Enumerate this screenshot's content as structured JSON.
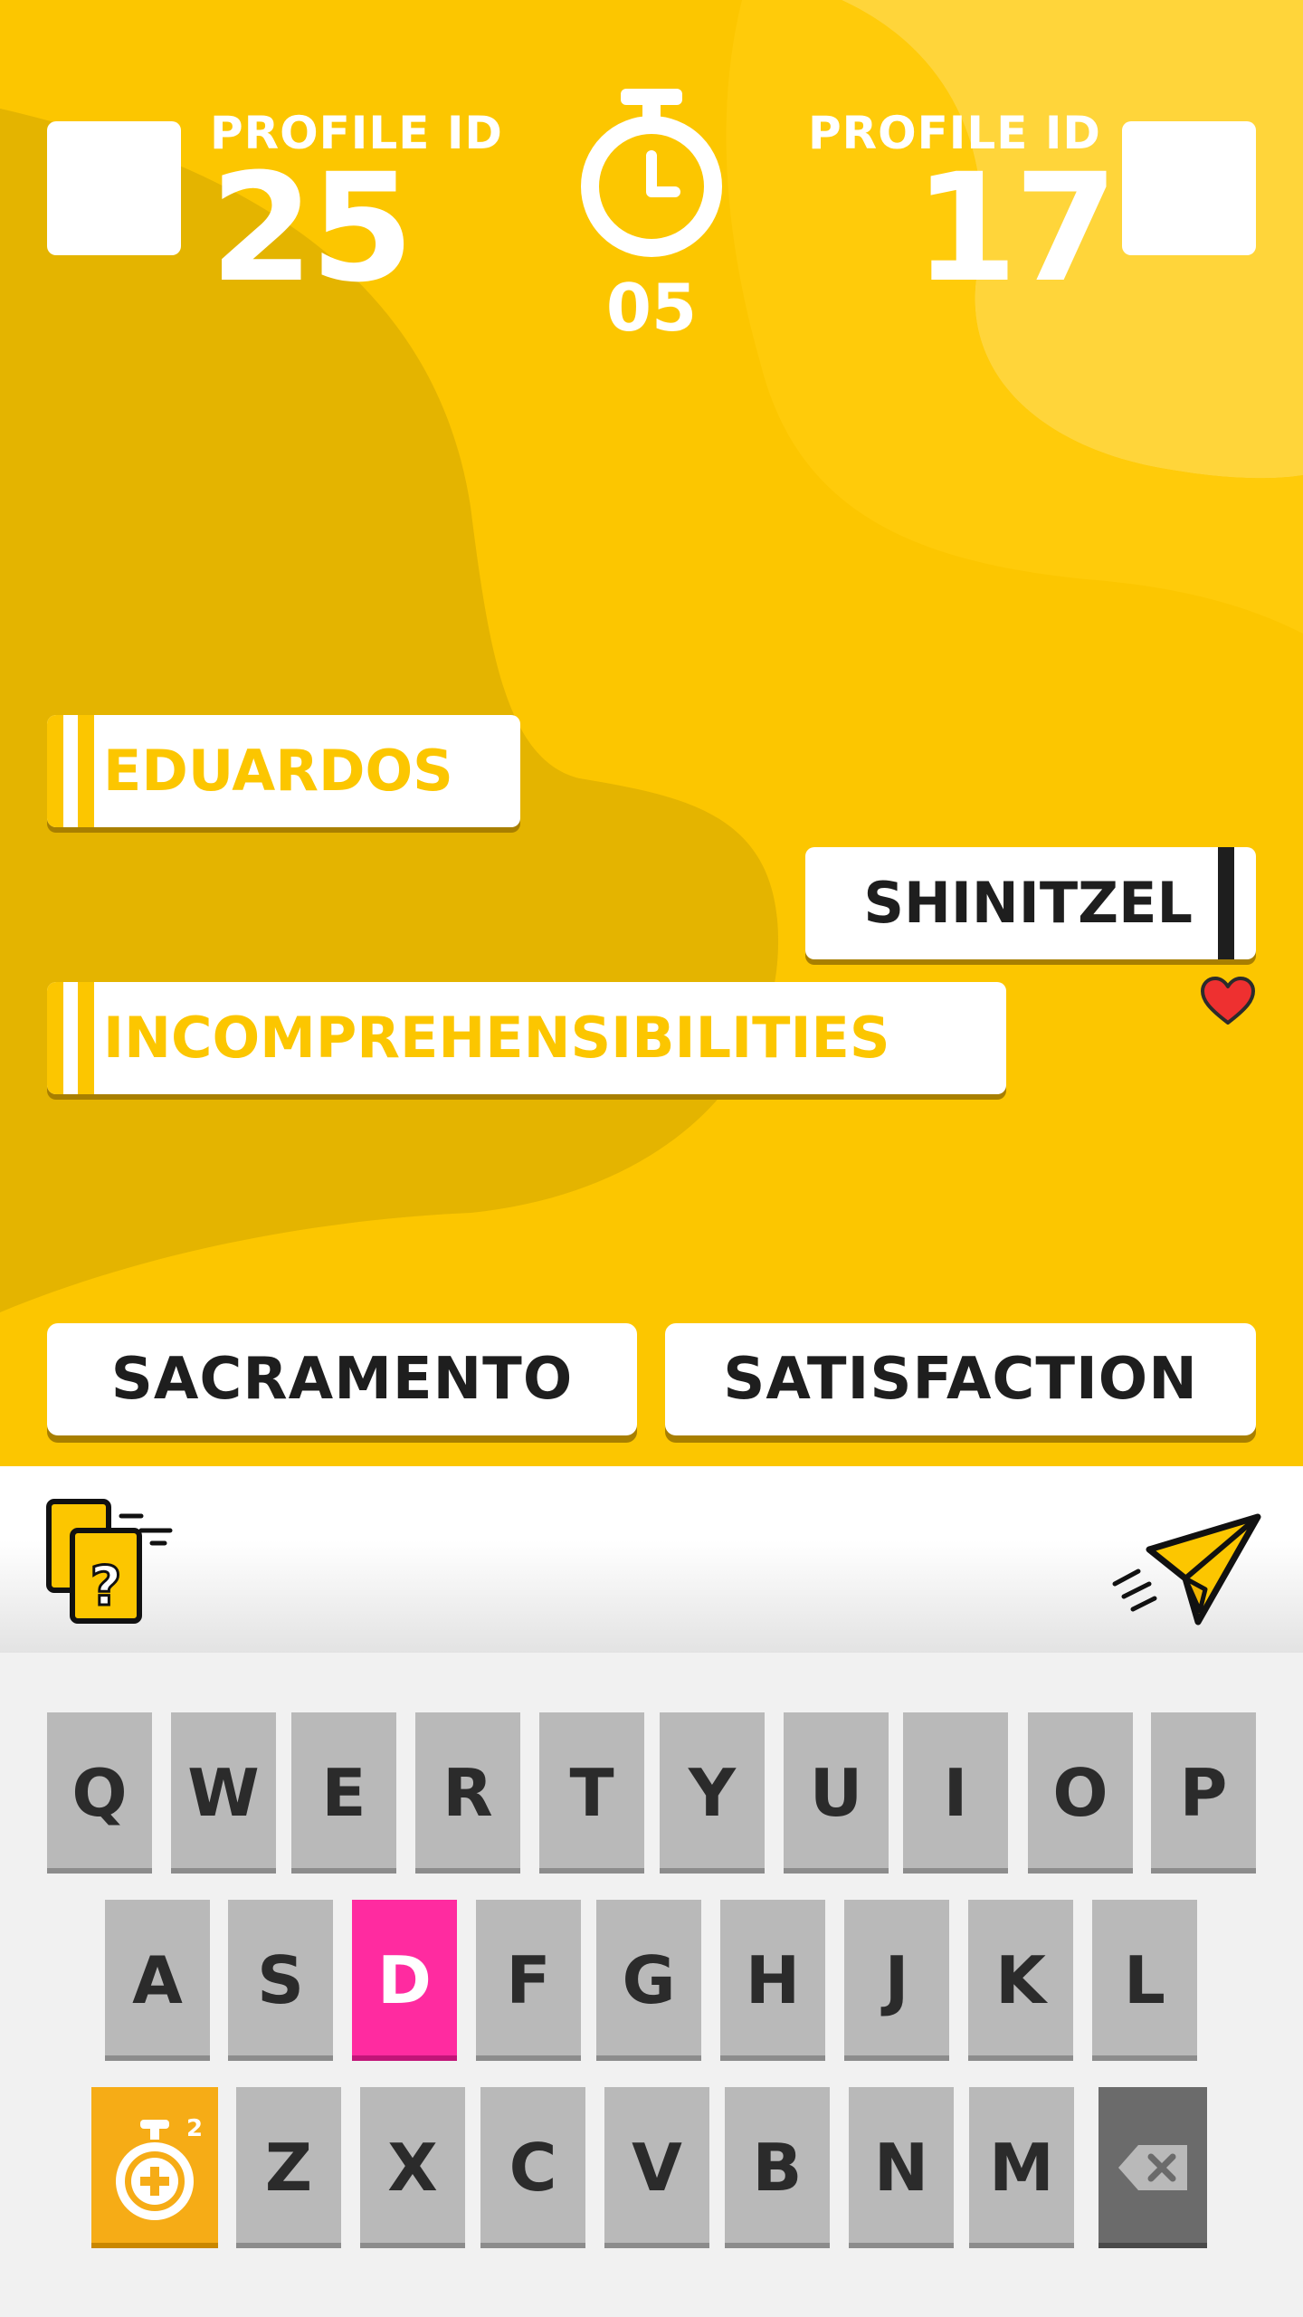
{
  "player_left": {
    "label": "PROFILE ID",
    "number": "25"
  },
  "player_right": {
    "label": "PROFILE ID",
    "number": "17"
  },
  "timer": {
    "value": "05"
  },
  "played_words": [
    {
      "text": "EDUARDOS",
      "owner": "opponent"
    },
    {
      "text": "SHINITZEL",
      "owner": "me",
      "liked": true
    },
    {
      "text": "INCOMPREHENSIBILITIES",
      "owner": "opponent"
    }
  ],
  "choices": [
    "SACRAMENTO",
    "SATISFACTION"
  ],
  "toolbar": {
    "hint_icon": "hint-cards-icon",
    "send_icon": "paper-plane-icon"
  },
  "keyboard": {
    "row1": [
      "Q",
      "W",
      "E",
      "R",
      "T",
      "Y",
      "U",
      "I",
      "O",
      "P"
    ],
    "row2": [
      "A",
      "S",
      "D",
      "F",
      "G",
      "H",
      "J",
      "K",
      "L"
    ],
    "row3": [
      "Z",
      "X",
      "C",
      "V",
      "B",
      "N",
      "M"
    ],
    "active_key": "D",
    "bonus_key": {
      "icon": "stopwatch-plus-icon",
      "count": "2"
    },
    "backspace_icon": "backspace-icon"
  },
  "colors": {
    "accent": "#fcc600",
    "active_key": "#ff2ba0",
    "bonus_key": "#f6ac16",
    "text_dark": "#1e1e1e"
  }
}
